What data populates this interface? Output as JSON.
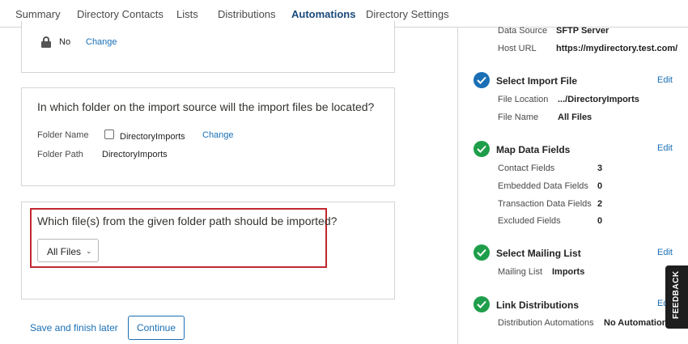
{
  "nav": {
    "tabs": [
      "Summary",
      "Directory Contacts",
      "Lists",
      "Distributions",
      "Automations",
      "Directory Settings"
    ],
    "active_tab": "Automations"
  },
  "card1": {
    "value": "No",
    "change": "Change"
  },
  "card2": {
    "question": "In which folder on the import source will the import files be located?",
    "folder_name_label": "Folder Name",
    "folder_name_value": "DirectoryImports",
    "change": "Change",
    "folder_path_label": "Folder Path",
    "folder_path_value": "DirectoryImports"
  },
  "card3": {
    "question": "Which file(s) from the given folder path should be imported?",
    "dropdown_value": "All Files"
  },
  "footer": {
    "save_later": "Save and finish later",
    "continue": "Continue"
  },
  "sidebar": {
    "data_source_label": "Data Source",
    "data_source_value": "SFTP Server",
    "host_url_label": "Host URL",
    "host_url_value": "https://mydirectory.test.com/",
    "steps": [
      {
        "title": "Select Import File",
        "edit": "Edit",
        "status": "blue",
        "rows": [
          {
            "label": "File Location",
            "value": ".../DirectoryImports"
          },
          {
            "label": "File Name",
            "value": "All Files"
          }
        ]
      },
      {
        "title": "Map Data Fields",
        "edit": "Edit",
        "status": "green",
        "rows": [
          {
            "label": "Contact Fields",
            "value": "3"
          },
          {
            "label": "Embedded Data Fields",
            "value": "0"
          },
          {
            "label": "Transaction Data Fields",
            "value": "2"
          },
          {
            "label": "Excluded Fields",
            "value": "0"
          }
        ]
      },
      {
        "title": "Select Mailing List",
        "edit": "Edit",
        "status": "green",
        "rows": [
          {
            "label": "Mailing List",
            "value": "Imports"
          }
        ]
      },
      {
        "title": "Link Distributions",
        "edit": "Ed",
        "status": "green",
        "rows": [
          {
            "label": "Distribution Automations",
            "value": "No Automations"
          }
        ]
      }
    ]
  },
  "feedback": "FEEDBACK",
  "colors": {
    "accent": "#1a6fb5",
    "success": "#1e9e4a",
    "highlight": "#c0282e"
  }
}
